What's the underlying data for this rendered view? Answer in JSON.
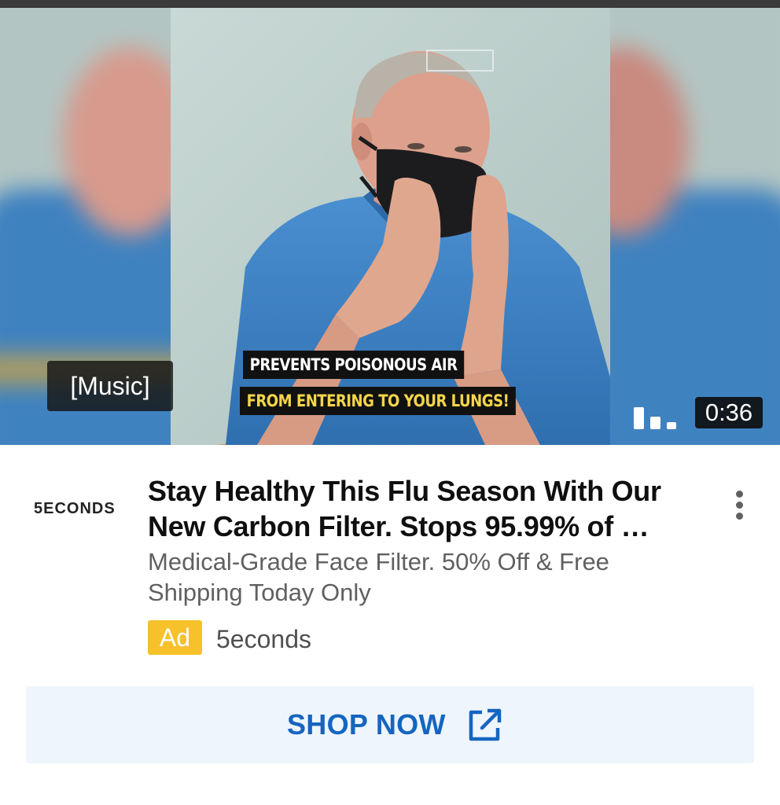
{
  "video": {
    "caption_line1": "PREVENTS POISONOUS AIR",
    "caption_line2": "FROM ENTERING TO YOUR LUNGS!",
    "subtitle": "[Music]",
    "duration": "0:36"
  },
  "ad": {
    "advertiser_logo_text": "5ECONDS",
    "title": "Stay Healthy This Flu Season With Our New Carbon Filter. Stops 95.99% of …",
    "description": "Medical-Grade Face Filter. 50% Off & Free Shipping Today Only",
    "badge": "Ad",
    "advertiser_name": "5econds"
  },
  "cta": {
    "label": "SHOP NOW",
    "icon": "open-in-new-icon"
  },
  "icons": {
    "menu": "more-vert-icon",
    "bars": "audio-bars-icon"
  },
  "colors": {
    "accent": "#1565c0",
    "cta_background": "#eef5fd",
    "ad_badge": "#f6c12a",
    "caption_highlight": "#f4d54b"
  }
}
